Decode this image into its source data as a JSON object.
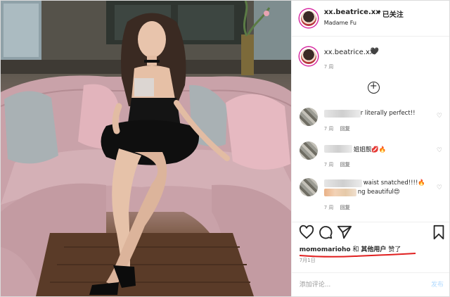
{
  "header": {
    "username": "xx.beatrice.xx",
    "separator": "•",
    "follow_status": "已关注",
    "location": "Madame Fu"
  },
  "caption": {
    "username": "xx.beatrice.xx",
    "emoji": "🖤",
    "time": "7 周"
  },
  "load_more_icon": "plus-circle-icon",
  "comments": [
    {
      "text_visible": "r literally perfect!!",
      "time": "7 周",
      "reply": "回复"
    },
    {
      "text_visible": "姐姐靓💋🔥",
      "time": "7 周",
      "reply": "回复"
    },
    {
      "text_visible_1": "waist snatched!!!!🔥",
      "text_visible_2": "ng beautiful😍",
      "time": "7 周",
      "reply": "回复"
    }
  ],
  "actions": {
    "like_icon": "heart-icon",
    "comment_icon": "comment-icon",
    "share_icon": "paper-plane-icon",
    "save_icon": "bookmark-icon"
  },
  "likes": {
    "user": "momomarioho",
    "and": "和",
    "others": "其他用户",
    "suffix": "赞了"
  },
  "post_date": "7月1日",
  "comment_input": {
    "placeholder": "添加评论...",
    "post_label": "发布"
  },
  "colors": {
    "story_ring": "#d6249f",
    "underline": "#e02020",
    "sofa": "#caa4aa",
    "dress": "#111111"
  }
}
